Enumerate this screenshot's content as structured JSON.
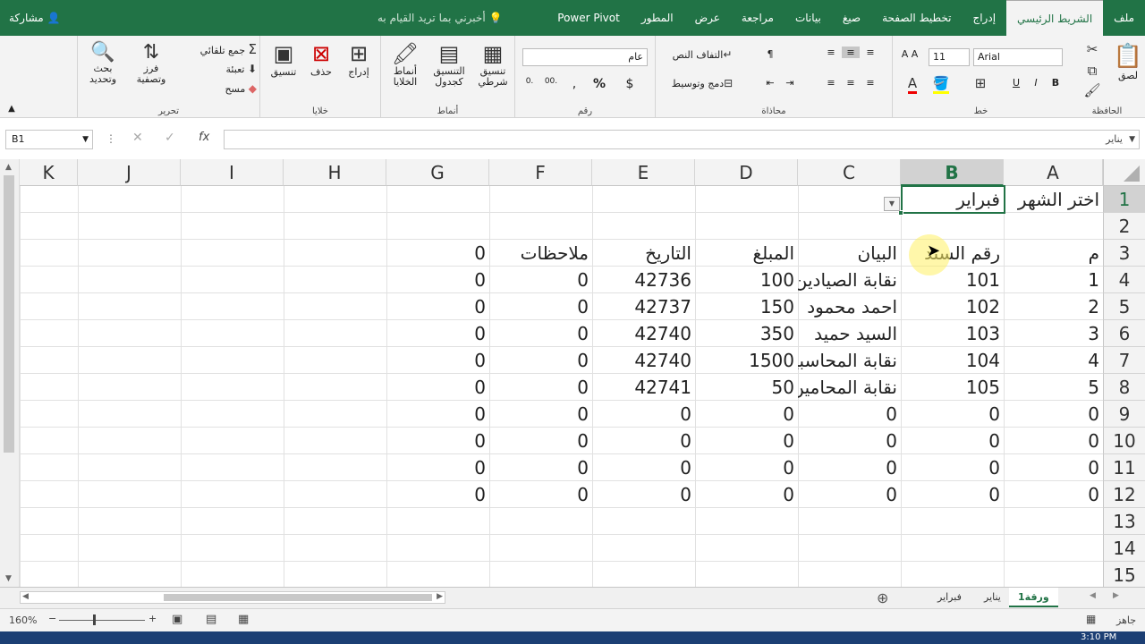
{
  "tabs": [
    "ملف",
    "الشريط الرئيسي",
    "إدراج",
    "تخطيط الصفحة",
    "صيغ",
    "بيانات",
    "مراجعة",
    "عرض",
    "المطور",
    "Power Pivot"
  ],
  "active_tab": "الشريط الرئيسي",
  "tellme": "أخبرني بما تريد القيام به",
  "share": "مشاركة",
  "ribbon": {
    "clipboard": {
      "label": "الحافظة",
      "paste": "لصق"
    },
    "font": {
      "label": "خط",
      "name": "Arial",
      "size": "11",
      "bold": "B",
      "italic": "I",
      "underline": "U"
    },
    "align": {
      "label": "محاذاة",
      "wrap": "التفاف النص",
      "merge": "دمج وتوسيط"
    },
    "number": {
      "label": "رقم",
      "format": "عام",
      "currency": "$",
      "percent": "%"
    },
    "styles": {
      "label": "أنماط",
      "conditional": "تنسيق شرطي",
      "table": "التنسيق كجدول",
      "cell": "أنماط الخلايا"
    },
    "cells": {
      "label": "خلايا",
      "insert": "إدراج",
      "delete": "حذف",
      "format": "تنسيق"
    },
    "editing": {
      "label": "تحرير",
      "autosum": "جمع تلقائي",
      "fill": "تعبئة",
      "clear": "مسح",
      "sort": "فرز وتصفية",
      "find": "بحث وتحديد"
    }
  },
  "namebox": "B1",
  "formula": "يناير",
  "columns": [
    "A",
    "B",
    "C",
    "D",
    "E",
    "F",
    "G",
    "H",
    "I",
    "J",
    "K"
  ],
  "rows": [
    "1",
    "2",
    "3",
    "4",
    "5",
    "6",
    "7",
    "8",
    "9",
    "10",
    "11",
    "12",
    "13",
    "14",
    "15"
  ],
  "cells": {
    "r1": {
      "A": "اختر الشهر",
      "B": "فبراير"
    },
    "r3": {
      "A": "م",
      "B": "رقم السند",
      "C": "البيان",
      "D": "المبلغ",
      "E": "التاريخ",
      "F": "ملاحظات",
      "G": "0"
    },
    "data": [
      [
        "1",
        "101",
        "نقابة الصيادين",
        "100",
        "42736",
        "0",
        "0"
      ],
      [
        "2",
        "102",
        "احمد محمود",
        "150",
        "42737",
        "0",
        "0"
      ],
      [
        "3",
        "103",
        "السيد حميد",
        "350",
        "42740",
        "0",
        "0"
      ],
      [
        "4",
        "104",
        "نقابة المحاسبين",
        "1500",
        "42740",
        "0",
        "0"
      ],
      [
        "5",
        "105",
        "نقابة المحامين",
        "50",
        "42741",
        "0",
        "0"
      ],
      [
        "0",
        "0",
        "0",
        "0",
        "0",
        "0",
        "0"
      ],
      [
        "0",
        "0",
        "0",
        "0",
        "0",
        "0",
        "0"
      ],
      [
        "0",
        "0",
        "0",
        "0",
        "0",
        "0",
        "0"
      ],
      [
        "0",
        "0",
        "0",
        "0",
        "0",
        "0",
        "0"
      ]
    ]
  },
  "sheets": [
    "ورقة1",
    "يناير",
    "فبراير"
  ],
  "active_sheet": "ورقة1",
  "status": {
    "ready": "جاهز",
    "zoom": "160%"
  },
  "clock": "3:10 PM"
}
